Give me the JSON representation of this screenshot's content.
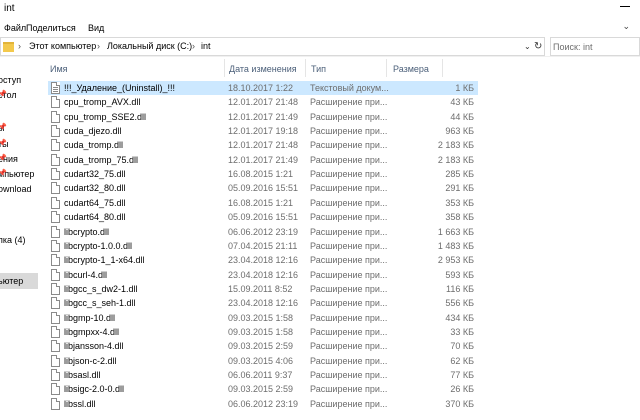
{
  "window": {
    "title": "int"
  },
  "ribbon": {
    "tabs": [
      "Файл",
      "Поделиться",
      "Вид"
    ]
  },
  "address": {
    "crumbs": [
      "Этот компьютер",
      "Локальный диск (C:)",
      "int"
    ],
    "separator": "›"
  },
  "search": {
    "placeholder": "Поиск: int"
  },
  "nav": {
    "items": [
      {
        "label": "оступ",
        "pinned": false,
        "selected": false
      },
      {
        "label": "стол",
        "pinned": true,
        "selected": false
      },
      {
        "label": "ы",
        "pinned": true,
        "selected": false
      },
      {
        "label": "ты",
        "pinned": true,
        "selected": false
      },
      {
        "label": "ения",
        "pinned": true,
        "selected": false
      },
      {
        "label": "мпьютер",
        "pinned": true,
        "selected": false
      },
      {
        "label": "ownload",
        "pinned": false,
        "selected": false
      },
      {
        "label": "пка (4)",
        "pinned": false,
        "selected": false
      },
      {
        "label": "ьютер",
        "pinned": false,
        "selected": true
      }
    ]
  },
  "columns": {
    "name": "Имя",
    "date": "Дата изменения",
    "type": "Тип",
    "size": "Размера"
  },
  "files": [
    {
      "name": "!!!_Удаление_(Uninstall)_!!!",
      "date": "18.10.2017 1:22",
      "type": "Текстовый докум...",
      "size": "1 КБ",
      "icon": "text-file",
      "selected": true
    },
    {
      "name": "cpu_tromp_AVX.dll",
      "date": "12.01.2017 21:48",
      "type": "Расширение при...",
      "size": "43 КБ",
      "icon": "dll-file",
      "selected": false
    },
    {
      "name": "cpu_tromp_SSE2.dll",
      "date": "12.01.2017 21:49",
      "type": "Расширение при...",
      "size": "44 КБ",
      "icon": "dll-file",
      "selected": false
    },
    {
      "name": "cuda_djezo.dll",
      "date": "12.01.2017 19:18",
      "type": "Расширение при...",
      "size": "963 КБ",
      "icon": "dll-file",
      "selected": false
    },
    {
      "name": "cuda_tromp.dll",
      "date": "12.01.2017 21:48",
      "type": "Расширение при...",
      "size": "2 183 КБ",
      "icon": "dll-file",
      "selected": false
    },
    {
      "name": "cuda_tromp_75.dll",
      "date": "12.01.2017 21:49",
      "type": "Расширение при...",
      "size": "2 183 КБ",
      "icon": "dll-file",
      "selected": false
    },
    {
      "name": "cudart32_75.dll",
      "date": "16.08.2015 1:21",
      "type": "Расширение при...",
      "size": "285 КБ",
      "icon": "dll-file",
      "selected": false
    },
    {
      "name": "cudart32_80.dll",
      "date": "05.09.2016 15:51",
      "type": "Расширение при...",
      "size": "291 КБ",
      "icon": "dll-file",
      "selected": false
    },
    {
      "name": "cudart64_75.dll",
      "date": "16.08.2015 1:21",
      "type": "Расширение при...",
      "size": "353 КБ",
      "icon": "dll-file",
      "selected": false
    },
    {
      "name": "cudart64_80.dll",
      "date": "05.09.2016 15:51",
      "type": "Расширение при...",
      "size": "358 КБ",
      "icon": "dll-file",
      "selected": false
    },
    {
      "name": "libcrypto.dll",
      "date": "06.06.2012 23:19",
      "type": "Расширение при...",
      "size": "1 663 КБ",
      "icon": "dll-file",
      "selected": false
    },
    {
      "name": "libcrypto-1.0.0.dll",
      "date": "07.04.2015 21:11",
      "type": "Расширение при...",
      "size": "1 483 КБ",
      "icon": "dll-file",
      "selected": false
    },
    {
      "name": "libcrypto-1_1-x64.dll",
      "date": "23.04.2018 12:16",
      "type": "Расширение при...",
      "size": "2 953 КБ",
      "icon": "dll-file",
      "selected": false
    },
    {
      "name": "libcurl-4.dll",
      "date": "23.04.2018 12:16",
      "type": "Расширение при...",
      "size": "593 КБ",
      "icon": "dll-file",
      "selected": false
    },
    {
      "name": "libgcc_s_dw2-1.dll",
      "date": "15.09.2011 8:52",
      "type": "Расширение при...",
      "size": "116 КБ",
      "icon": "dll-file",
      "selected": false
    },
    {
      "name": "libgcc_s_seh-1.dll",
      "date": "23.04.2018 12:16",
      "type": "Расширение при...",
      "size": "556 КБ",
      "icon": "dll-file",
      "selected": false
    },
    {
      "name": "libgmp-10.dll",
      "date": "09.03.2015 1:58",
      "type": "Расширение при...",
      "size": "434 КБ",
      "icon": "dll-file",
      "selected": false
    },
    {
      "name": "libgmpxx-4.dll",
      "date": "09.03.2015 1:58",
      "type": "Расширение при...",
      "size": "33 КБ",
      "icon": "dll-file",
      "selected": false
    },
    {
      "name": "libjansson-4.dll",
      "date": "09.03.2015 2:59",
      "type": "Расширение при...",
      "size": "70 КБ",
      "icon": "dll-file",
      "selected": false
    },
    {
      "name": "libjson-c-2.dll",
      "date": "09.03.2015 4:06",
      "type": "Расширение при...",
      "size": "62 КБ",
      "icon": "dll-file",
      "selected": false
    },
    {
      "name": "libsasl.dll",
      "date": "06.06.2011 9:37",
      "type": "Расширение при...",
      "size": "77 КБ",
      "icon": "dll-file",
      "selected": false
    },
    {
      "name": "libsigc-2.0-0.dll",
      "date": "09.03.2015 2:59",
      "type": "Расширение при...",
      "size": "26 КБ",
      "icon": "dll-file",
      "selected": false
    },
    {
      "name": "libssl.dll",
      "date": "06.06.2012 23:19",
      "type": "Расширение при...",
      "size": "370 КБ",
      "icon": "dll-file",
      "selected": false
    }
  ],
  "colors": {
    "selection": "#cce8ff",
    "header_text": "#4c607a",
    "meta_text": "#6d6d6d",
    "nav_selected": "#d9d9d9"
  }
}
